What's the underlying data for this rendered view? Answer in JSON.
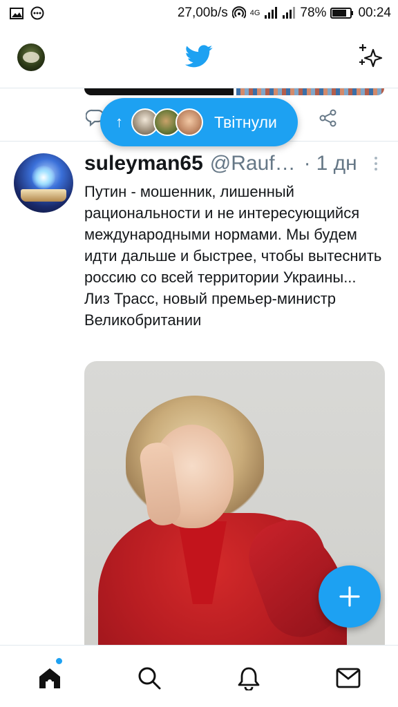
{
  "status_bar": {
    "speed": "27,00b/s",
    "network": "4G",
    "battery": "78%",
    "time": "00:24"
  },
  "header": {
    "logo_icon": "twitter-bird-icon",
    "timeline_icon": "sparkle-icon"
  },
  "new_tweets_pill": {
    "label": "Твітнули"
  },
  "tweet": {
    "display_name": "suleyman65",
    "handle": "@Rauf…",
    "separator": "·",
    "time": "1 дн",
    "text": "Путин - мошенник, лишенный рациональности и не интересующийся международными нормами. Мы будем идти дальше и быстрее, чтобы вытеснить россию со всей территории Украины...\nЛиз Трасс, новый премьер-министр Великобритании"
  },
  "bottom_nav": {
    "items": [
      "home-icon",
      "search-icon",
      "notifications-icon",
      "messages-icon"
    ],
    "home_has_badge": true
  },
  "colors": {
    "accent": "#1da1f2",
    "text": "#14171a",
    "secondary_text": "#657786"
  }
}
